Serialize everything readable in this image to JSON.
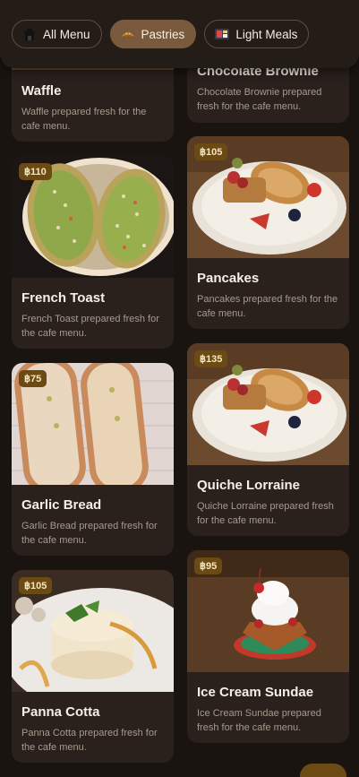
{
  "categories": [
    {
      "label": "All Menu",
      "icon": "house-icon"
    },
    {
      "label": "Pastries",
      "icon": "croissant-icon"
    },
    {
      "label": "Light Meals",
      "icon": "bento-icon"
    }
  ],
  "active_category": "Pastries",
  "menu": [
    {
      "name": "Waffle",
      "description": "Waffle prepared fresh for the cafe menu."
    },
    {
      "name": "Chocolate Brownie",
      "description": "Chocolate Brownie prepared fresh for the cafe menu."
    },
    {
      "name": "French Toast",
      "price": "฿110",
      "description": "French Toast prepared fresh for the cafe menu."
    },
    {
      "name": "Pancakes",
      "price": "฿105",
      "description": "Pancakes prepared fresh for the cafe menu."
    },
    {
      "name": "Garlic Bread",
      "price": "฿75",
      "description": "Garlic Bread prepared fresh for the cafe menu."
    },
    {
      "name": "Quiche Lorraine",
      "price": "฿135",
      "description": "Quiche Lorraine prepared fresh for the cafe menu."
    },
    {
      "name": "Panna Cotta",
      "price": "฿105",
      "description": "Panna Cotta prepared fresh for the cafe menu."
    },
    {
      "name": "Ice Cream Sundae",
      "price": "฿95",
      "description": "Ice Cream Sundae prepared fresh for the cafe menu."
    }
  ]
}
